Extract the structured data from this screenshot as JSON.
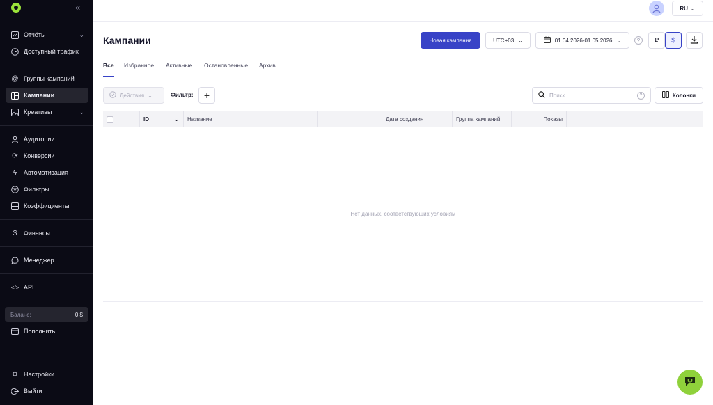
{
  "sidebar": {
    "collapse_icon": "double-chevron-left",
    "items": [
      {
        "label": "Отчёты",
        "icon": "chart-icon",
        "has_chevron": true
      },
      {
        "label": "Доступный трафик",
        "icon": "clock-icon"
      },
      {
        "label": "Группы кампаний",
        "icon": "at-icon"
      },
      {
        "label": "Кампании",
        "icon": "grid-icon",
        "active": true
      },
      {
        "label": "Креативы",
        "icon": "image-icon",
        "has_chevron": true
      },
      {
        "label": "Аудитории",
        "icon": "audience-icon"
      },
      {
        "label": "Конверсии",
        "icon": "refresh-icon"
      },
      {
        "label": "Автоматизация",
        "icon": "bolt-icon"
      },
      {
        "label": "Фильтры",
        "icon": "filter-icon"
      },
      {
        "label": "Коэффициенты",
        "icon": "table-icon"
      },
      {
        "label": "Финансы",
        "icon": "dollar-icon"
      },
      {
        "label": "Менеджер",
        "icon": "chat-icon"
      },
      {
        "label": "API",
        "icon": "code-icon"
      },
      {
        "label": "Пополнить",
        "icon": "wallet-icon"
      },
      {
        "label": "Настройки",
        "icon": "gear-icon"
      },
      {
        "label": "Выйти",
        "icon": "logout-icon"
      }
    ],
    "balance": {
      "label": "Баланс:",
      "value": "0 $"
    }
  },
  "topbar": {
    "language": "RU"
  },
  "header": {
    "title": "Кампании",
    "new_campaign": "Новая кампания",
    "timezone": "UTC+03",
    "date_range": "01.04.2026-01.05.2026",
    "currency_rub": "₽",
    "currency_usd": "$",
    "selected_currency": "USD"
  },
  "tabs": [
    "Все",
    "Избранное",
    "Активные",
    "Остановленные",
    "Архив"
  ],
  "active_tab": "Все",
  "toolbar": {
    "actions": "Действия",
    "filter_label": "Фильтр:",
    "search_placeholder": "Поиск",
    "columns": "Колонки"
  },
  "table": {
    "columns": [
      "ID",
      "Название",
      "Дата создания",
      "Группа кампаний",
      "Показы"
    ],
    "empty_message": "Нет данных, соответствующих условиям"
  },
  "colors": {
    "accent": "#3843c7",
    "sidebar_bg": "#0b0b15",
    "brand_green": "#8fd13b"
  }
}
